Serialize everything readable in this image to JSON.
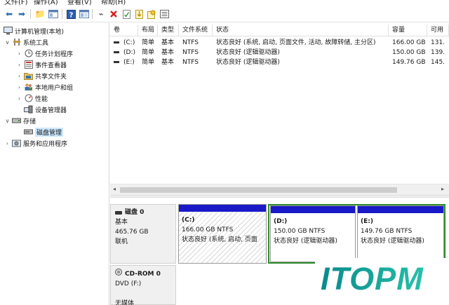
{
  "menu": [
    "文件(F)",
    "操作(A)",
    "查看(V)",
    "帮助(H)"
  ],
  "toolbar": {
    "icons": [
      "back-icon",
      "forward-icon",
      "up-folder-icon",
      "console-tree-icon",
      "help-icon",
      "view-icon",
      "connect-icon",
      "delete-icon",
      "properties-icon",
      "import-icon",
      "export-icon",
      "list-icon"
    ],
    "delete_color": "#d6201e"
  },
  "tree": {
    "root": "计算机管理(本地)",
    "system_tools": "系统工具",
    "task_scheduler": "任务计划程序",
    "event_viewer": "事件查看器",
    "shared_folders": "共享文件夹",
    "local_users": "本地用户和组",
    "performance": "性能",
    "device_manager": "设备管理器",
    "storage": "存储",
    "disk_management": "磁盘管理",
    "services": "服务和应用程序"
  },
  "volumes": {
    "headers": [
      "卷",
      "布局",
      "类型",
      "文件系统",
      "状态",
      "容量",
      "可用"
    ],
    "rows": [
      [
        "(C:)",
        "简单",
        "基本",
        "NTFS",
        "状态良好 (系统, 启动, 页面文件, 活动, 故障转储, 主分区)",
        "166.00 GB",
        "131."
      ],
      [
        "(D:)",
        "简单",
        "基本",
        "NTFS",
        "状态良好 (逻辑驱动器)",
        "150.00 GB",
        "139."
      ],
      [
        "(E:)",
        "简单",
        "基本",
        "NTFS",
        "状态良好 (逻辑驱动器)",
        "149.76 GB",
        "145."
      ]
    ]
  },
  "disk0": {
    "title": "磁盘 0",
    "type": "基本",
    "size": "465.76 GB",
    "status": "联机",
    "partitions": [
      {
        "name": "(C:)",
        "size": "166.00 GB NTFS",
        "status": "状态良好 (系统, 启动, 页面"
      },
      {
        "name": "(D:)",
        "size": "150.00 GB NTFS",
        "status": "状态良好 (逻辑驱动器)"
      },
      {
        "name": "(E:)",
        "size": "149.76 GB NTFS",
        "status": "状态良好 (逻辑驱动器)"
      }
    ]
  },
  "cdrom": {
    "title": "CD-ROM 0",
    "type": "DVD (F:)",
    "status": "无媒体"
  },
  "watermark": "ITOPM",
  "colors": {
    "primary_partition_bar": "#1919c8",
    "extended_border": "#2e8b2e",
    "selection": "#cce8ff"
  }
}
